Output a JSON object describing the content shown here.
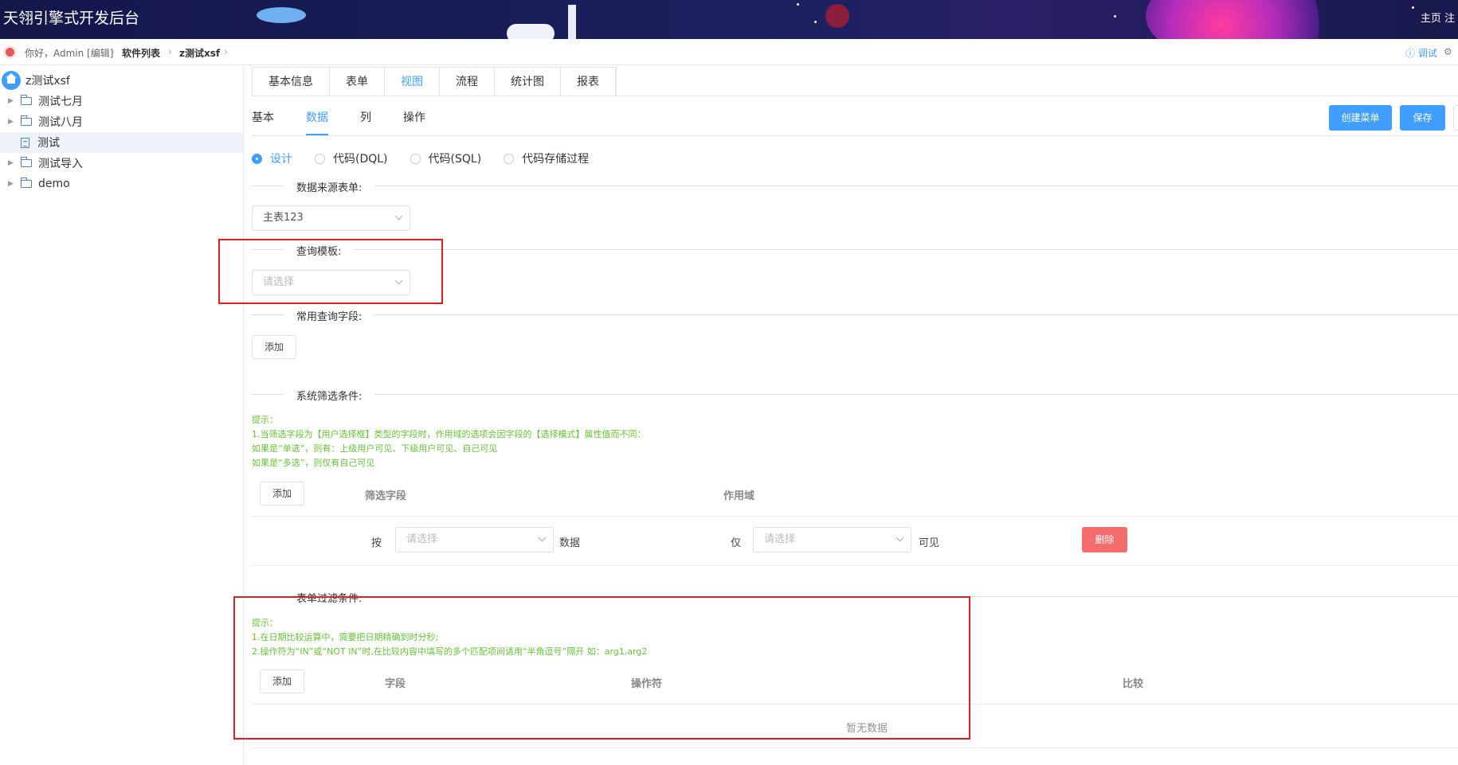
{
  "header": {
    "app_title": "天翎引擎式开发后台",
    "links": "主页 注"
  },
  "breadcrumb": {
    "greeting": "你好，Admin [编辑]",
    "level1": "软件列表",
    "level2": "z测试xsf",
    "right_debug": "ⓘ 调试",
    "right_settings": "⚙"
  },
  "sidebar": {
    "root": "z测试xsf",
    "items": [
      {
        "label": "测试七月",
        "type": "folder"
      },
      {
        "label": "测试八月",
        "type": "folder"
      },
      {
        "label": "测试",
        "type": "doc"
      },
      {
        "label": "测试导入",
        "type": "folder"
      },
      {
        "label": "demo",
        "type": "folder"
      }
    ]
  },
  "tabs": [
    "基本信息",
    "表单",
    "视图",
    "流程",
    "统计图",
    "报表"
  ],
  "subtabs": [
    "基本",
    "数据",
    "列",
    "操作"
  ],
  "buttons": {
    "create_menu": "创建菜单",
    "save": "保存"
  },
  "radios": [
    "设计",
    "代码(DQL)",
    "代码(SQL)",
    "代码存储过程"
  ],
  "sections": {
    "data_source": "数据来源表单:",
    "data_source_value": "主表123",
    "query_template": "查询模板:",
    "query_template_placeholder": "请选择",
    "common_fields": "常用查询字段:",
    "add": "添加",
    "system_filter": "系统筛选条件:",
    "system_hint": [
      "提示：",
      "1.当筛选字段为【用户选择框】类型的字段时，作用域的选项会因字段的【选择模式】属性值而不同：",
      "如果是“单选”，则有：上级用户可见、下级用户可见、自己可见",
      "如果是“多选”，则仅有自己可见"
    ],
    "system_table": {
      "col_field": "筛选字段",
      "col_scope": "作用域",
      "row_prefix": "按",
      "row_field_placeholder": "请选择",
      "row_mid": "数据",
      "row_only": "仅",
      "row_scope_placeholder": "请选择",
      "row_visible": "可见",
      "delete": "删除"
    },
    "form_filter": "表单过滤条件:",
    "form_hint": [
      "提示：",
      "1.在日期比较运算中，需要把日期精确到时分秒;",
      "2.操作符为“IN”或“NOT IN”时,在比较内容中填写的多个匹配项间请用“半角逗号”隔开 如：arg1,arg2"
    ],
    "form_table": {
      "col_field": "字段",
      "col_operator": "操作符",
      "col_compare": "比较",
      "empty": "暂无数据"
    }
  },
  "colors": {
    "accent": "#409eff",
    "danger": "#f56c6c",
    "hint": "#67c23a",
    "highlight": "#e02020"
  }
}
